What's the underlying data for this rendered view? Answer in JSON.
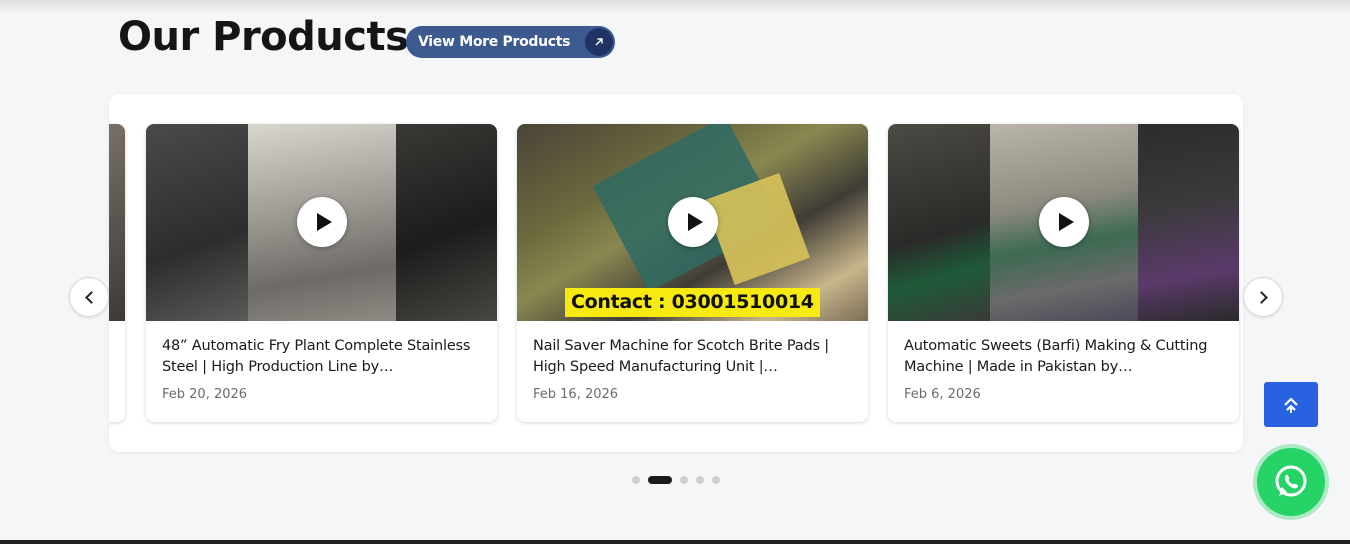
{
  "section": {
    "title": "Our Products",
    "view_more_label": "View More Products"
  },
  "products": [
    {
      "title": "48” Automatic Fry Plant Complete Stainless Steel | High Production Line by…",
      "date": "Feb 20, 2026"
    },
    {
      "title": "Nail Saver Machine for Scotch Brite Pads | High Speed Manufacturing Unit |…",
      "date": "Feb 16, 2026",
      "banner": "Contact : 03001510014"
    },
    {
      "title": "Automatic Sweets (Barfi) Making & Cutting Machine | Made in Pakistan by…",
      "date": "Feb 6, 2026"
    }
  ],
  "carousel": {
    "page_count": 5,
    "active_page": 2
  },
  "colors": {
    "accent": "#3d5a8f",
    "scroll_top": "#2962e0",
    "whatsapp": "#25d366",
    "banner": "#f6ea10"
  },
  "icons": {
    "view_more": "arrow-up-right-icon",
    "prev": "chevron-left-icon",
    "next": "chevron-right-icon",
    "play": "play-icon",
    "scroll_top": "double-chevron-up-icon",
    "whatsapp": "whatsapp-icon"
  }
}
